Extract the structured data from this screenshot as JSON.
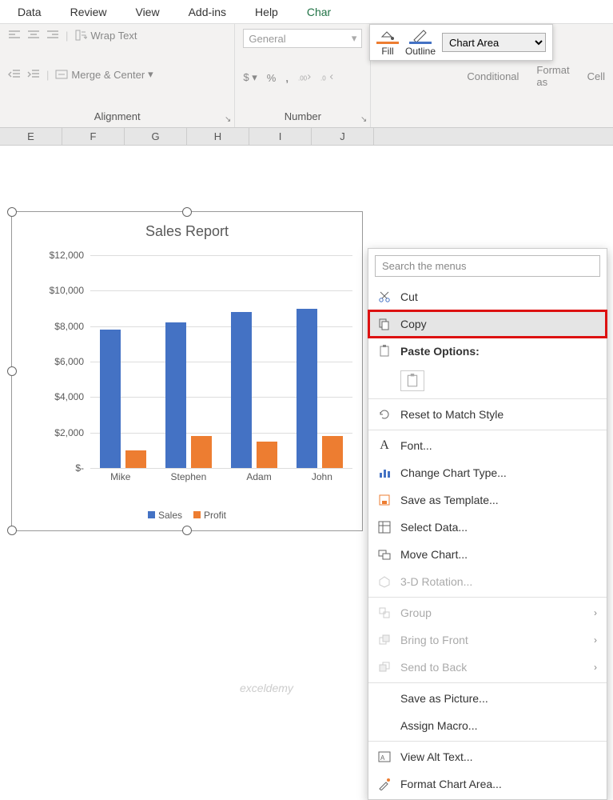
{
  "tabs": [
    "Data",
    "Review",
    "View",
    "Add-ins",
    "Help",
    "Char"
  ],
  "ribbon": {
    "alignment": {
      "wrap": "Wrap Text",
      "merge": "Merge & Center",
      "title": "Alignment"
    },
    "number": {
      "format": "General",
      "title": "Number"
    },
    "styles": {
      "conditional": "Conditional",
      "formatas": "Format as",
      "cell": "Cell"
    }
  },
  "mini_toolbar": {
    "fill": "Fill",
    "outline": "Outline",
    "selector_value": "Chart Area"
  },
  "columns": [
    "E",
    "F",
    "G",
    "H",
    "I",
    "J"
  ],
  "ctx": {
    "search_placeholder": "Search the menus",
    "cut": "Cut",
    "copy": "Copy",
    "paste_options": "Paste Options:",
    "reset": "Reset to Match Style",
    "font": "Font...",
    "change_type": "Change Chart Type...",
    "save_template": "Save as Template...",
    "select_data": "Select Data...",
    "move_chart": "Move Chart...",
    "rotation": "3-D Rotation...",
    "group": "Group",
    "bring_front": "Bring to Front",
    "send_back": "Send to Back",
    "save_picture": "Save as Picture...",
    "assign_macro": "Assign Macro...",
    "alt_text": "View Alt Text...",
    "format_chart": "Format Chart Area..."
  },
  "watermark": "exceldemy",
  "chart_data": {
    "type": "bar",
    "title": "Sales Report",
    "categories": [
      "Mike",
      "Stephen",
      "Adam",
      "John"
    ],
    "series": [
      {
        "name": "Sales",
        "values": [
          7800,
          8200,
          8800,
          9000
        ],
        "color": "#4472c4"
      },
      {
        "name": "Profit",
        "values": [
          1000,
          1800,
          1500,
          1800
        ],
        "color": "#ed7d31"
      }
    ],
    "ylim": [
      0,
      12000
    ],
    "ytick_step": 2000,
    "ytick_labels": [
      "$12,000",
      "$10,000",
      "$8,000",
      "$6,000",
      "$4,000",
      "$2,000",
      "$-"
    ],
    "xlabel": "",
    "ylabel": ""
  }
}
